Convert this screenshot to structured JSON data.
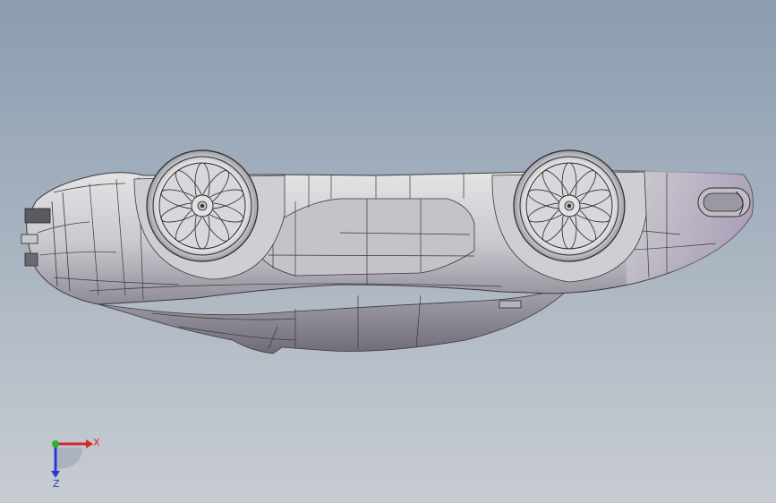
{
  "view": {
    "background_top": "#8b9db0",
    "background_bottom": "#c8ccd2"
  },
  "model": {
    "body_color": "#d6d6da",
    "shadow_color": "#7e7a88",
    "edge_color": "#3a3a3a",
    "accent_tint": "#a99bb5"
  },
  "triad": {
    "x_label": "X",
    "z_label": "Z",
    "x_color": "#d22a2a",
    "y_color": "#2bb52b",
    "z_color": "#2a3ad2"
  }
}
